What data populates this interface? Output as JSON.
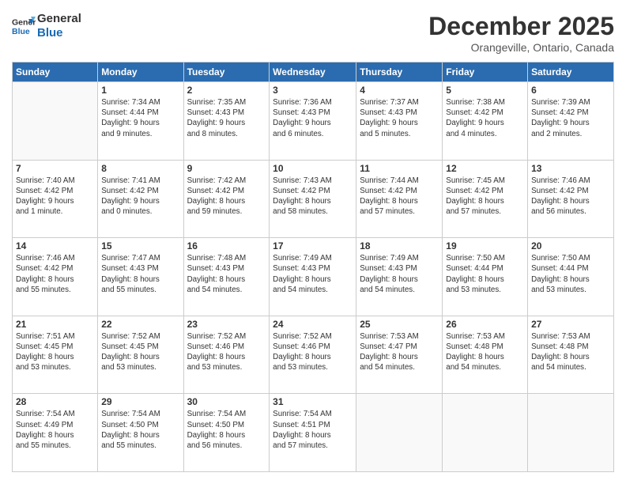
{
  "logo": {
    "line1": "General",
    "line2": "Blue"
  },
  "title": "December 2025",
  "subtitle": "Orangeville, Ontario, Canada",
  "days_header": [
    "Sunday",
    "Monday",
    "Tuesday",
    "Wednesday",
    "Thursday",
    "Friday",
    "Saturday"
  ],
  "weeks": [
    [
      {
        "day": "",
        "info": ""
      },
      {
        "day": "1",
        "info": "Sunrise: 7:34 AM\nSunset: 4:44 PM\nDaylight: 9 hours\nand 9 minutes."
      },
      {
        "day": "2",
        "info": "Sunrise: 7:35 AM\nSunset: 4:43 PM\nDaylight: 9 hours\nand 8 minutes."
      },
      {
        "day": "3",
        "info": "Sunrise: 7:36 AM\nSunset: 4:43 PM\nDaylight: 9 hours\nand 6 minutes."
      },
      {
        "day": "4",
        "info": "Sunrise: 7:37 AM\nSunset: 4:43 PM\nDaylight: 9 hours\nand 5 minutes."
      },
      {
        "day": "5",
        "info": "Sunrise: 7:38 AM\nSunset: 4:42 PM\nDaylight: 9 hours\nand 4 minutes."
      },
      {
        "day": "6",
        "info": "Sunrise: 7:39 AM\nSunset: 4:42 PM\nDaylight: 9 hours\nand 2 minutes."
      }
    ],
    [
      {
        "day": "7",
        "info": "Sunrise: 7:40 AM\nSunset: 4:42 PM\nDaylight: 9 hours\nand 1 minute."
      },
      {
        "day": "8",
        "info": "Sunrise: 7:41 AM\nSunset: 4:42 PM\nDaylight: 9 hours\nand 0 minutes."
      },
      {
        "day": "9",
        "info": "Sunrise: 7:42 AM\nSunset: 4:42 PM\nDaylight: 8 hours\nand 59 minutes."
      },
      {
        "day": "10",
        "info": "Sunrise: 7:43 AM\nSunset: 4:42 PM\nDaylight: 8 hours\nand 58 minutes."
      },
      {
        "day": "11",
        "info": "Sunrise: 7:44 AM\nSunset: 4:42 PM\nDaylight: 8 hours\nand 57 minutes."
      },
      {
        "day": "12",
        "info": "Sunrise: 7:45 AM\nSunset: 4:42 PM\nDaylight: 8 hours\nand 57 minutes."
      },
      {
        "day": "13",
        "info": "Sunrise: 7:46 AM\nSunset: 4:42 PM\nDaylight: 8 hours\nand 56 minutes."
      }
    ],
    [
      {
        "day": "14",
        "info": "Sunrise: 7:46 AM\nSunset: 4:42 PM\nDaylight: 8 hours\nand 55 minutes."
      },
      {
        "day": "15",
        "info": "Sunrise: 7:47 AM\nSunset: 4:43 PM\nDaylight: 8 hours\nand 55 minutes."
      },
      {
        "day": "16",
        "info": "Sunrise: 7:48 AM\nSunset: 4:43 PM\nDaylight: 8 hours\nand 54 minutes."
      },
      {
        "day": "17",
        "info": "Sunrise: 7:49 AM\nSunset: 4:43 PM\nDaylight: 8 hours\nand 54 minutes."
      },
      {
        "day": "18",
        "info": "Sunrise: 7:49 AM\nSunset: 4:43 PM\nDaylight: 8 hours\nand 54 minutes."
      },
      {
        "day": "19",
        "info": "Sunrise: 7:50 AM\nSunset: 4:44 PM\nDaylight: 8 hours\nand 53 minutes."
      },
      {
        "day": "20",
        "info": "Sunrise: 7:50 AM\nSunset: 4:44 PM\nDaylight: 8 hours\nand 53 minutes."
      }
    ],
    [
      {
        "day": "21",
        "info": "Sunrise: 7:51 AM\nSunset: 4:45 PM\nDaylight: 8 hours\nand 53 minutes."
      },
      {
        "day": "22",
        "info": "Sunrise: 7:52 AM\nSunset: 4:45 PM\nDaylight: 8 hours\nand 53 minutes."
      },
      {
        "day": "23",
        "info": "Sunrise: 7:52 AM\nSunset: 4:46 PM\nDaylight: 8 hours\nand 53 minutes."
      },
      {
        "day": "24",
        "info": "Sunrise: 7:52 AM\nSunset: 4:46 PM\nDaylight: 8 hours\nand 53 minutes."
      },
      {
        "day": "25",
        "info": "Sunrise: 7:53 AM\nSunset: 4:47 PM\nDaylight: 8 hours\nand 54 minutes."
      },
      {
        "day": "26",
        "info": "Sunrise: 7:53 AM\nSunset: 4:48 PM\nDaylight: 8 hours\nand 54 minutes."
      },
      {
        "day": "27",
        "info": "Sunrise: 7:53 AM\nSunset: 4:48 PM\nDaylight: 8 hours\nand 54 minutes."
      }
    ],
    [
      {
        "day": "28",
        "info": "Sunrise: 7:54 AM\nSunset: 4:49 PM\nDaylight: 8 hours\nand 55 minutes."
      },
      {
        "day": "29",
        "info": "Sunrise: 7:54 AM\nSunset: 4:50 PM\nDaylight: 8 hours\nand 55 minutes."
      },
      {
        "day": "30",
        "info": "Sunrise: 7:54 AM\nSunset: 4:50 PM\nDaylight: 8 hours\nand 56 minutes."
      },
      {
        "day": "31",
        "info": "Sunrise: 7:54 AM\nSunset: 4:51 PM\nDaylight: 8 hours\nand 57 minutes."
      },
      {
        "day": "",
        "info": ""
      },
      {
        "day": "",
        "info": ""
      },
      {
        "day": "",
        "info": ""
      }
    ]
  ]
}
